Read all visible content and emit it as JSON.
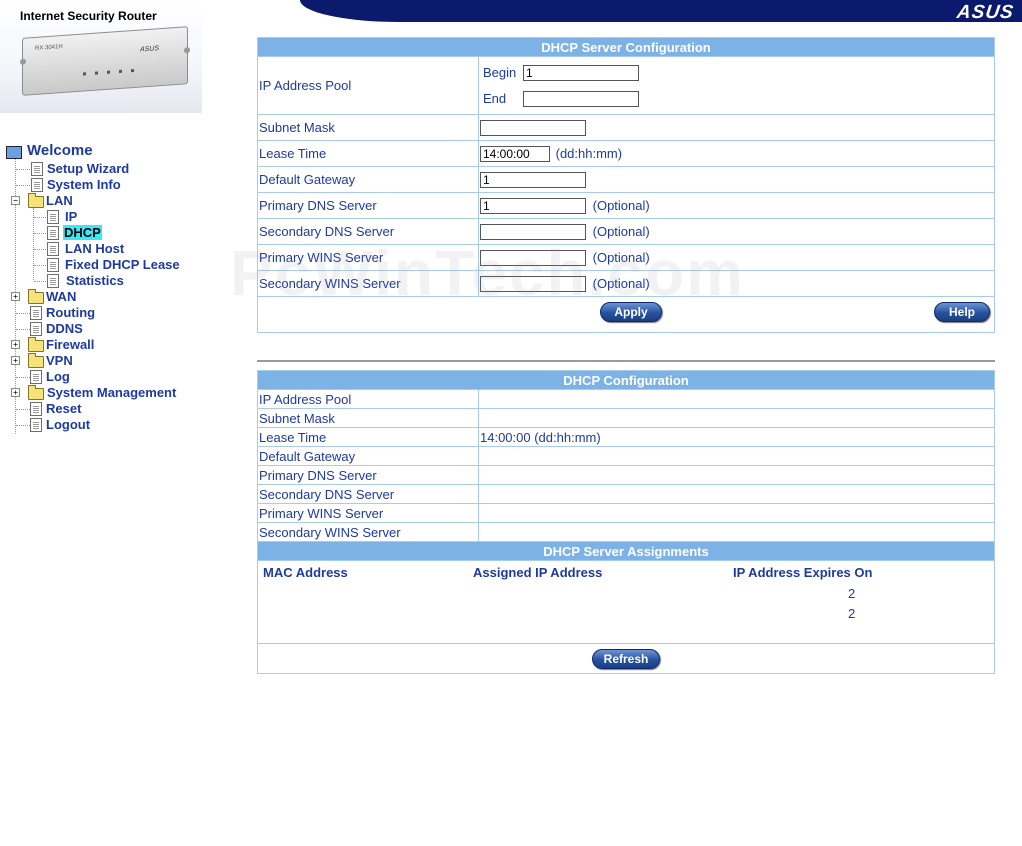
{
  "header": {
    "product_title": "Internet Security Router",
    "brand": "ASUS",
    "router_label": "RX 3041H",
    "router_brand": "ASUS"
  },
  "nav": {
    "welcome": "Welcome",
    "items": [
      {
        "label": "Setup Wizard"
      },
      {
        "label": "System Info"
      },
      {
        "label": "LAN"
      },
      {
        "label": "IP"
      },
      {
        "label": "DHCP"
      },
      {
        "label": "LAN Host"
      },
      {
        "label": "Fixed DHCP Lease"
      },
      {
        "label": "Statistics"
      },
      {
        "label": "WAN"
      },
      {
        "label": "Routing"
      },
      {
        "label": "DDNS"
      },
      {
        "label": "Firewall"
      },
      {
        "label": "VPN"
      },
      {
        "label": "Log"
      },
      {
        "label": "System Management"
      },
      {
        "label": "Reset"
      },
      {
        "label": "Logout"
      }
    ]
  },
  "server_config": {
    "title": "DHCP Server Configuration",
    "ip_pool_label": "IP Address Pool",
    "begin_label": "Begin",
    "begin_value": "1",
    "end_label": "End",
    "end_value": "",
    "subnet_label": "Subnet Mask",
    "subnet_value": "",
    "lease_label": "Lease Time",
    "lease_value": "14:00:00",
    "lease_unit": "(dd:hh:mm)",
    "gateway_label": "Default Gateway",
    "gateway_value": "1",
    "pdns_label": "Primary DNS Server",
    "pdns_value": "1",
    "sdns_label": "Secondary DNS Server",
    "sdns_value": "",
    "pwins_label": "Primary WINS Server",
    "pwins_value": "",
    "swins_label": "Secondary WINS Server",
    "swins_value": "",
    "optional": "(Optional)",
    "apply": "Apply",
    "help": "Help"
  },
  "watermark": "PcWinTech.com",
  "dhcp_config": {
    "title": "DHCP Configuration",
    "rows": [
      {
        "label": "IP Address Pool",
        "value": ""
      },
      {
        "label": "Subnet Mask",
        "value": ""
      },
      {
        "label": "Lease Time",
        "value": "14:00:00 (dd:hh:mm)"
      },
      {
        "label": "Default Gateway",
        "value": ""
      },
      {
        "label": "Primary DNS Server",
        "value": ""
      },
      {
        "label": "Secondary DNS Server",
        "value": ""
      },
      {
        "label": "Primary WINS Server",
        "value": ""
      },
      {
        "label": "Secondary WINS Server",
        "value": ""
      }
    ]
  },
  "assignments": {
    "title": "DHCP Server Assignments",
    "col_mac": "MAC Address",
    "col_ip": "Assigned IP Address",
    "col_expires": "IP Address Expires On",
    "rows": [
      {
        "mac": "",
        "ip": "",
        "expires": "2"
      },
      {
        "mac": "",
        "ip": "",
        "expires": "2"
      },
      {
        "mac": "",
        "ip": "",
        "expires": ""
      }
    ],
    "refresh": "Refresh"
  },
  "colors": {
    "header_band": "#0c1a6e",
    "table_head": "#7cb2e6",
    "nav_text": "#1e3aa0",
    "active_highlight": "#38e8f6"
  }
}
